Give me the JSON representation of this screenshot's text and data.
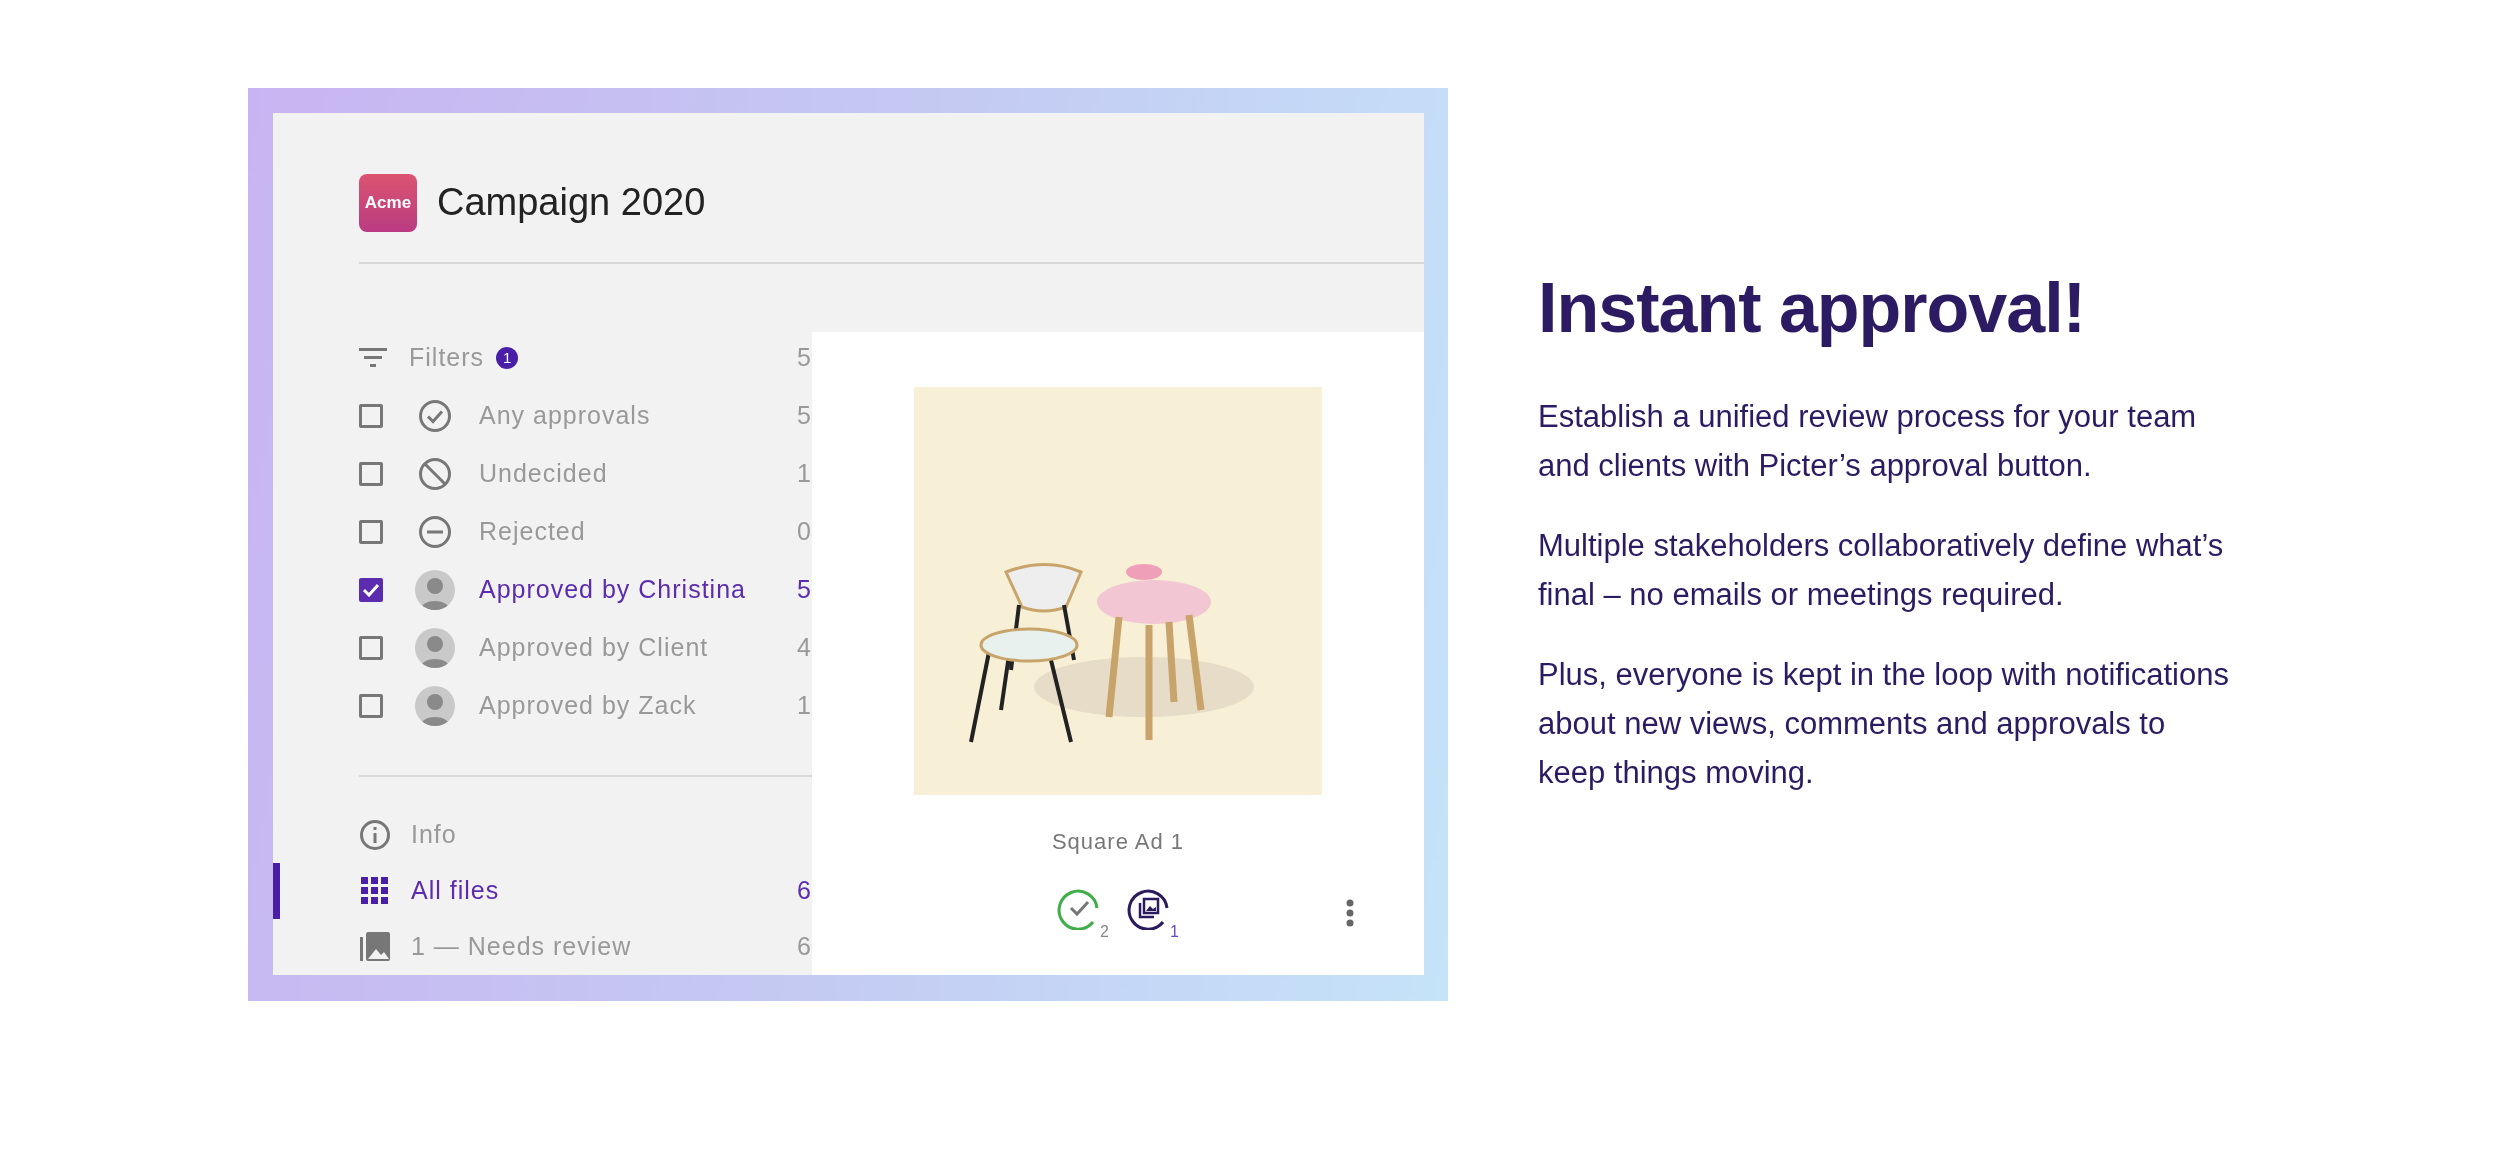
{
  "app": {
    "logo_text": "Acme",
    "title": "Campaign 2020"
  },
  "filters": {
    "label": "Filters",
    "badge": "1",
    "count": "5",
    "items": [
      {
        "kind": "any",
        "label": "Any approvals",
        "count": "5",
        "checked": false
      },
      {
        "kind": "undecided",
        "label": "Undecided",
        "count": "1",
        "checked": false
      },
      {
        "kind": "rejected",
        "label": "Rejected",
        "count": "0",
        "checked": false
      },
      {
        "kind": "person",
        "label": "Approved by Christina",
        "count": "5",
        "checked": true
      },
      {
        "kind": "person",
        "label": "Approved by Client",
        "count": "4",
        "checked": false
      },
      {
        "kind": "person",
        "label": "Approved by Zack",
        "count": "1",
        "checked": false
      }
    ]
  },
  "nav": [
    {
      "kind": "info",
      "label": "Info",
      "selected": false
    },
    {
      "kind": "grid",
      "label": "All files",
      "count": "6",
      "selected": true
    },
    {
      "kind": "image",
      "label": "1 — Needs review",
      "count": "6",
      "selected": false
    }
  ],
  "card": {
    "title": "Square Ad 1",
    "approvals": "2",
    "versions": "1"
  },
  "text": {
    "heading": "Instant approval!",
    "paragraphs": [
      "Establish a unified review process for your team and clients with Picter’s approval button.",
      "Multiple stakeholders collaboratively define what’s final – no emails or meetings required.",
      "Plus, everyone is kept in the loop with notifications about new views, comments and approvals to keep things moving."
    ]
  }
}
